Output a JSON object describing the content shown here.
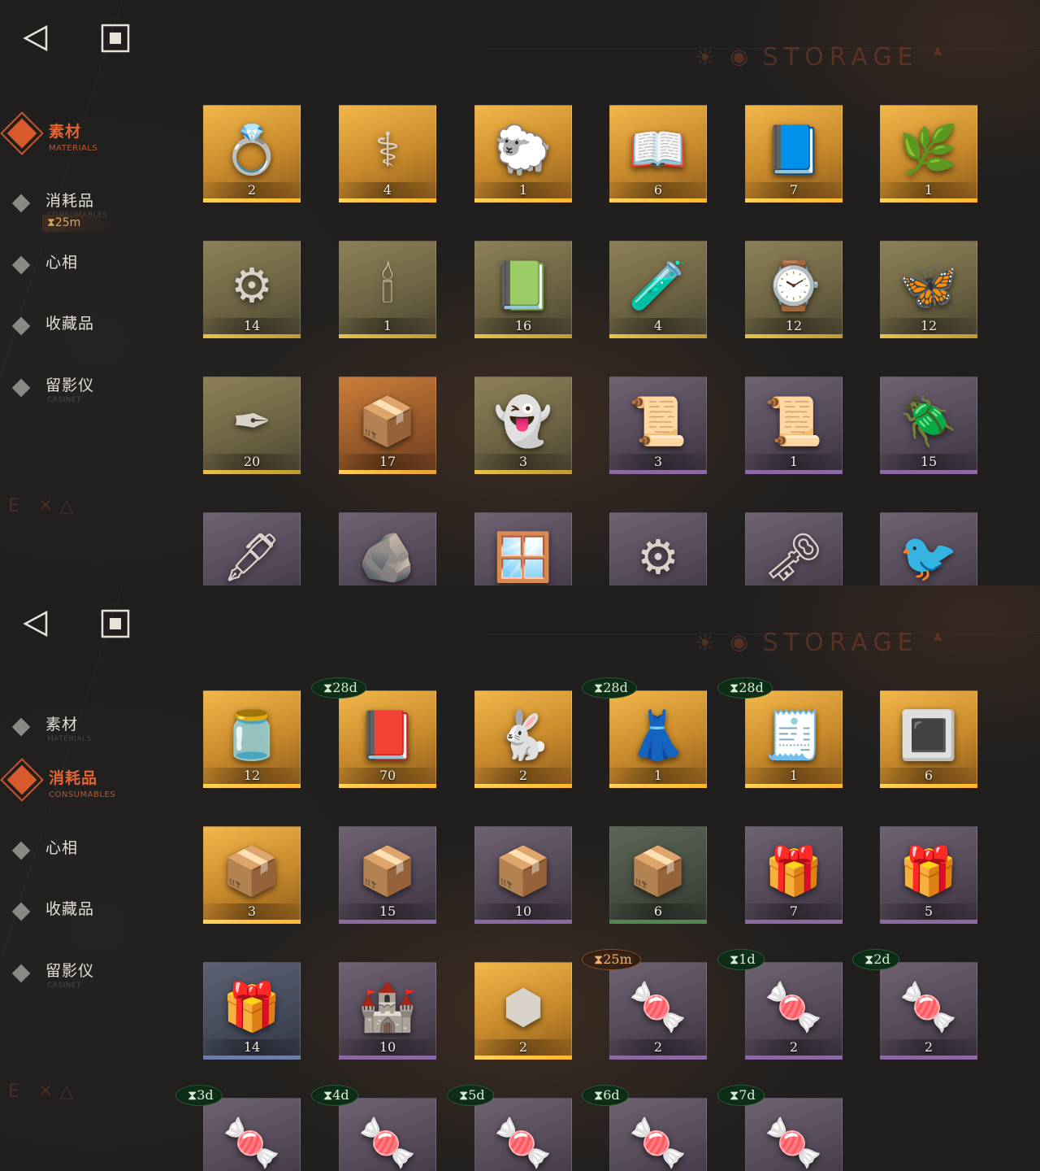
{
  "colors": {
    "accent": "#e06436",
    "timer_green": "#0e3018",
    "timer_orange": "#3b2416"
  },
  "panels": [
    {
      "header": {
        "title": "STORAGE",
        "back_icon": "back-triangle-icon",
        "home_icon": "square-home-icon"
      },
      "nav": [
        {
          "label": "素材",
          "sub": "MATERIALS",
          "active": true
        },
        {
          "label": "消耗品",
          "sub": "CONSUMABLES",
          "active": false,
          "timer": "⧗25m"
        },
        {
          "label": "心相",
          "sub": "",
          "active": false
        },
        {
          "label": "收藏品",
          "sub": "",
          "active": false
        },
        {
          "label": "留影仪",
          "sub": "CASINET",
          "active": false
        }
      ],
      "items": [
        {
          "icon": "gold-ring-icon",
          "glyph": "💍",
          "count": "2",
          "rarity": "gold"
        },
        {
          "icon": "caduceus-icon",
          "glyph": "⚕",
          "count": "4",
          "rarity": "gold"
        },
        {
          "icon": "gilded-sheep-icon",
          "glyph": "🐑",
          "count": "1",
          "rarity": "gold"
        },
        {
          "icon": "red-rune-book-icon",
          "glyph": "📖",
          "count": "6",
          "rarity": "gold"
        },
        {
          "icon": "blue-rune-book-icon",
          "glyph": "📘",
          "count": "7",
          "rarity": "gold"
        },
        {
          "icon": "overgrown-chest-icon",
          "glyph": "🌿",
          "count": "1",
          "rarity": "gold"
        },
        {
          "icon": "astrolabe-icon",
          "glyph": "⚙",
          "count": "14",
          "rarity": "olive"
        },
        {
          "icon": "ouija-board-icon",
          "glyph": "🕯",
          "count": "1",
          "rarity": "olive"
        },
        {
          "icon": "green-tablet-icon",
          "glyph": "📗",
          "count": "16",
          "rarity": "olive"
        },
        {
          "icon": "potion-bottle-icon",
          "glyph": "🧪",
          "count": "4",
          "rarity": "olive"
        },
        {
          "icon": "pocket-watch-icon",
          "glyph": "⌚",
          "count": "12",
          "rarity": "olive"
        },
        {
          "icon": "firefly-icon",
          "glyph": "🦋",
          "count": "12",
          "rarity": "olive"
        },
        {
          "icon": "bullets-icon",
          "glyph": "✒",
          "count": "20",
          "rarity": "olive"
        },
        {
          "icon": "hand-box-icon",
          "glyph": "📦",
          "count": "17",
          "rarity": "orange"
        },
        {
          "icon": "ghost-icon",
          "glyph": "👻",
          "count": "3",
          "rarity": "olive"
        },
        {
          "icon": "red-scroll-icon",
          "glyph": "📜",
          "count": "3",
          "rarity": "purple"
        },
        {
          "icon": "green-scroll-icon",
          "glyph": "📜",
          "count": "1",
          "rarity": "purple"
        },
        {
          "icon": "beetle-pendant-icon",
          "glyph": "🪲",
          "count": "15",
          "rarity": "purple"
        },
        {
          "icon": "pen-chain-icon",
          "glyph": "🖋",
          "count": "",
          "rarity": "purple"
        },
        {
          "icon": "stone-slab-icon",
          "glyph": "🪨",
          "count": "",
          "rarity": "purple"
        },
        {
          "icon": "frame-icon",
          "glyph": "🪟",
          "count": "",
          "rarity": "purple"
        },
        {
          "icon": "mechanical-fan-icon",
          "glyph": "⚙",
          "count": "",
          "rarity": "purple"
        },
        {
          "icon": "winged-key-icon",
          "glyph": "🗝",
          "count": "",
          "rarity": "purple"
        },
        {
          "icon": "bird-figurine-icon",
          "glyph": "🐦",
          "count": "",
          "rarity": "purple"
        }
      ]
    },
    {
      "header": {
        "title": "STORAGE",
        "back_icon": "back-triangle-icon",
        "home_icon": "square-home-icon"
      },
      "nav": [
        {
          "label": "素材",
          "sub": "MATERIALS",
          "active": false
        },
        {
          "label": "消耗品",
          "sub": "CONSUMABLES",
          "active": true
        },
        {
          "label": "心相",
          "sub": "",
          "active": false
        },
        {
          "label": "收藏品",
          "sub": "",
          "active": false
        },
        {
          "label": "留影仪",
          "sub": "CASINET",
          "active": false
        }
      ],
      "items": [
        {
          "icon": "candy-jar-icon",
          "glyph": "🫙",
          "count": "12",
          "rarity": "gold"
        },
        {
          "icon": "red-device-icon",
          "glyph": "📕",
          "count": "70",
          "rarity": "gold",
          "timer": "⧗28d",
          "timer_color": "green"
        },
        {
          "icon": "rabbit-box-icon",
          "glyph": "🐇",
          "count": "2",
          "rarity": "gold"
        },
        {
          "icon": "mannequin-icon",
          "glyph": "👗",
          "count": "1",
          "rarity": "gold",
          "timer": "⧗28d",
          "timer_color": "green"
        },
        {
          "icon": "shopping-list-icon",
          "glyph": "🧾",
          "count": "1",
          "rarity": "gold",
          "timer": "⧗28d",
          "timer_color": "green"
        },
        {
          "icon": "rune-table-icon",
          "glyph": "🔳",
          "count": "6",
          "rarity": "gold"
        },
        {
          "icon": "wooden-crate-icon",
          "glyph": "📦",
          "count": "3",
          "rarity": "gold"
        },
        {
          "icon": "wooden-crate-icon",
          "glyph": "📦",
          "count": "15",
          "rarity": "purple"
        },
        {
          "icon": "wooden-crate-icon",
          "glyph": "📦",
          "count": "10",
          "rarity": "purple"
        },
        {
          "icon": "wooden-crate-icon",
          "glyph": "📦",
          "count": "6",
          "rarity": "green"
        },
        {
          "icon": "parcel-icon",
          "glyph": "🎁",
          "count": "7",
          "rarity": "purple"
        },
        {
          "icon": "parcel-icon",
          "glyph": "🎁",
          "count": "5",
          "rarity": "purple"
        },
        {
          "icon": "parcel-icon",
          "glyph": "🎁",
          "count": "14",
          "rarity": "blue"
        },
        {
          "icon": "sandcastle-icon",
          "glyph": "🏰",
          "count": "10",
          "rarity": "purple"
        },
        {
          "icon": "hexagon-puzzle-icon",
          "glyph": "⬢",
          "count": "2",
          "rarity": "gold"
        },
        {
          "icon": "candy-icon",
          "glyph": "🍬",
          "count": "2",
          "rarity": "purple",
          "timer": "⧗25m",
          "timer_color": "orange"
        },
        {
          "icon": "candy-icon",
          "glyph": "🍬",
          "count": "2",
          "rarity": "purple",
          "timer": "⧗1d",
          "timer_color": "green"
        },
        {
          "icon": "candy-icon",
          "glyph": "🍬",
          "count": "2",
          "rarity": "purple",
          "timer": "⧗2d",
          "timer_color": "green"
        },
        {
          "icon": "candy-icon",
          "glyph": "🍬",
          "count": "",
          "rarity": "purple",
          "timer": "⧗3d",
          "timer_color": "green"
        },
        {
          "icon": "candy-icon",
          "glyph": "🍬",
          "count": "",
          "rarity": "purple",
          "timer": "⧗4d",
          "timer_color": "green"
        },
        {
          "icon": "candy-icon",
          "glyph": "🍬",
          "count": "",
          "rarity": "purple",
          "timer": "⧗5d",
          "timer_color": "green"
        },
        {
          "icon": "candy-icon",
          "glyph": "🍬",
          "count": "",
          "rarity": "purple",
          "timer": "⧗6d",
          "timer_color": "green"
        },
        {
          "icon": "candy-icon",
          "glyph": "🍬",
          "count": "",
          "rarity": "purple",
          "timer": "⧗7d",
          "timer_color": "green"
        }
      ]
    }
  ]
}
